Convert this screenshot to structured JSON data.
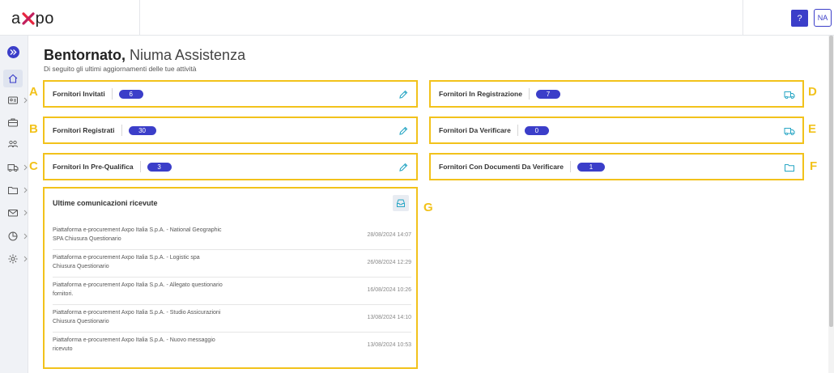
{
  "topbar": {
    "logo_text_left": "a",
    "logo_text_right": "po",
    "help_label": "?",
    "user_initials": "NA"
  },
  "header": {
    "welcome_strong": "Bentornato,",
    "welcome_name": "Niuma Assistenza",
    "subtitle": "Di seguito gli ultimi aggiornamenti delle tue attività"
  },
  "cards": [
    {
      "letter": "A",
      "label": "Fornitori Invitati",
      "count": "6",
      "icon": "pencil-icon"
    },
    {
      "letter": "B",
      "label": "Fornitori Registrati",
      "count": "30",
      "icon": "pencil-icon"
    },
    {
      "letter": "C",
      "label": "Fornitori In Pre-Qualifica",
      "count": "3",
      "icon": "pencil-icon"
    },
    {
      "letter": "D",
      "label": "Fornitori In Registrazione",
      "count": "7",
      "icon": "truck-icon"
    },
    {
      "letter": "E",
      "label": "Fornitori Da Verificare",
      "count": "0",
      "icon": "truck-icon"
    },
    {
      "letter": "F",
      "label": "Fornitori Con Documenti Da Verificare",
      "count": "1",
      "icon": "folder-icon"
    }
  ],
  "communications": {
    "letter": "G",
    "title": "Ultime comunicazioni ricevute",
    "icon": "inbox-icon",
    "items": [
      {
        "text": "Piattaforma e-procurement Axpo Italia S.p.A. - National Geographic SPA Chiusura Questionario",
        "date": "28/08/2024 14:07"
      },
      {
        "text": "Piattaforma e-procurement Axpo Italia S.p.A. - Logistic spa Chiusura Questionario",
        "date": "26/08/2024 12:29"
      },
      {
        "text": "Piattaforma e-procurement Axpo Italia S.p.A. - Allegato questionario fornitori.",
        "date": "16/08/2024 10:26"
      },
      {
        "text": "Piattaforma e-procurement Axpo Italia S.p.A. - Studio Assicurazioni Chiusura Questionario",
        "date": "13/08/2024 14:10"
      },
      {
        "text": "Piattaforma e-procurement Axpo Italia S.p.A. - Nuovo messaggio ricevuto",
        "date": "13/08/2024 10:53"
      }
    ]
  },
  "sidebar": {
    "items": [
      {
        "icon": "expand-icon"
      },
      {
        "icon": "home-icon"
      },
      {
        "icon": "id-card-icon",
        "has_submenu": true
      },
      {
        "icon": "briefcase-icon"
      },
      {
        "icon": "users-icon"
      },
      {
        "icon": "truck-icon",
        "has_submenu": true
      },
      {
        "icon": "folder-icon",
        "has_submenu": true
      },
      {
        "icon": "mail-icon",
        "has_submenu": true
      },
      {
        "icon": "chart-icon",
        "has_submenu": true
      },
      {
        "icon": "settings-icon",
        "has_submenu": true
      }
    ]
  },
  "colors": {
    "accent": "#3b3ec9",
    "highlight": "#f2c21b",
    "icon_teal": "#27a6c4"
  }
}
